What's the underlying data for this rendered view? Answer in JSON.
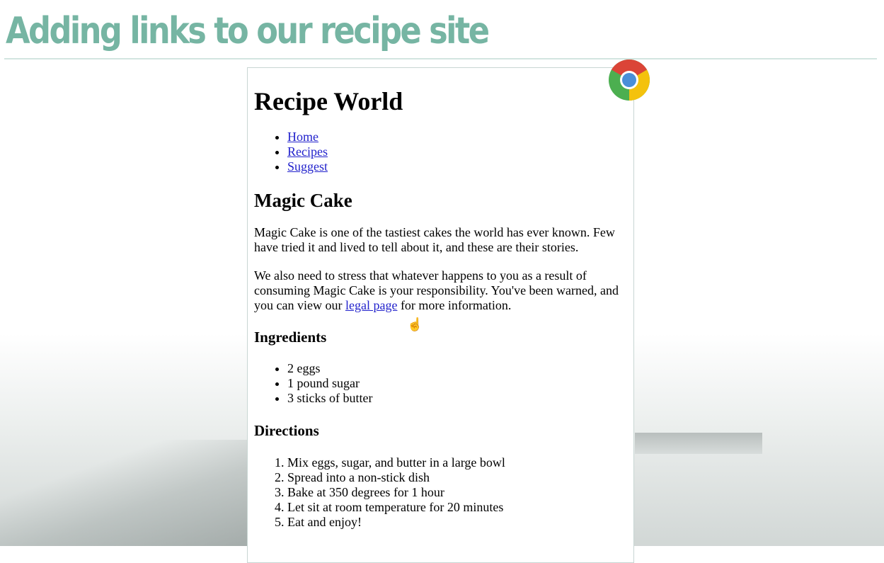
{
  "slide": {
    "title": "Adding links to our recipe site"
  },
  "page": {
    "site_title": "Recipe World",
    "nav": [
      "Home",
      "Recipes",
      "Suggest"
    ],
    "recipe_title": "Magic Cake",
    "intro": "Magic Cake is one of the tastiest cakes the world has ever known. Few have tried it and lived to tell about it, and these are their stories.",
    "warning_before": "We also need to stress that whatever happens to you as a result of consuming Magic Cake is your responsibility. You've been warned, and you can view our ",
    "warning_link": "legal page",
    "warning_after": " for more information.",
    "ingredients_title": "Ingredients",
    "ingredients": [
      "2 eggs",
      "1 pound sugar",
      "3 sticks of butter"
    ],
    "directions_title": "Directions",
    "directions": [
      "Mix eggs, sugar, and butter in a large bowl",
      "Spread into a non-stick dish",
      "Bake at 350 degrees for 1 hour",
      "Let sit at room temperature for 20 minutes",
      "Eat and enjoy!"
    ]
  },
  "colors": {
    "title": "#76b5a3",
    "link": "#2222cc"
  },
  "icons": {
    "browser": "chrome-logo-icon",
    "cursor": "hand-pointer-icon"
  }
}
